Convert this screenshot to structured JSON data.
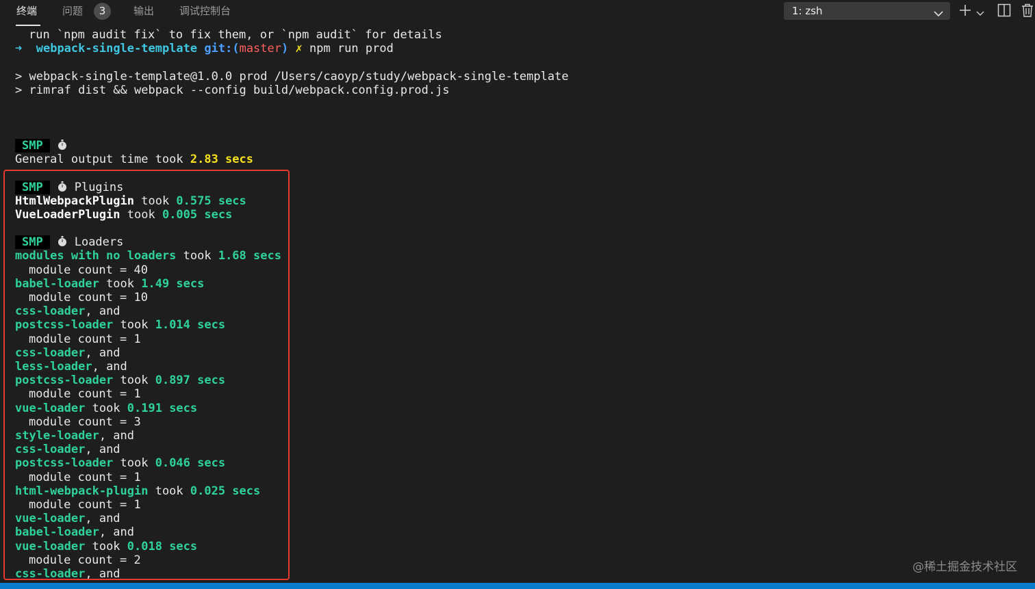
{
  "tabs": [
    {
      "label": "终端",
      "active": true
    },
    {
      "label": "问题",
      "badge": "3"
    },
    {
      "label": "输出"
    },
    {
      "label": "调试控制台"
    }
  ],
  "terminal_selector": {
    "value": "1: zsh"
  },
  "icons": [
    "plus-icon",
    "chevron-down-icon",
    "split-icon",
    "trash-icon",
    "stopwatch-icon"
  ],
  "colors": {
    "accent_green": "#2fd29a",
    "highlight_border": "#e63a2e",
    "statusbar": "#0a7acc"
  },
  "terminal": {
    "l1": "run `npm audit fix` to fix them, or `npm audit` for details",
    "prompt_arrow": "➜",
    "prompt_dir": "webpack-single-template",
    "prompt_git": "git:(",
    "prompt_branch": "master",
    "prompt_git_close": ")",
    "prompt_x": "✗",
    "prompt_cmd": "npm run prod",
    "l3": "> webpack-single-template@1.0.0 prod /Users/caoyp/study/webpack-single-template",
    "l4": "> rimraf dist && webpack --config build/webpack.config.prod.js",
    "smp": "SMP",
    "general_text": "General output time took ",
    "general_time": "2.83 secs",
    "plugins_title": "Plugins",
    "plugin1_name": "HtmlWebpackPlugin",
    "plugin1_time": "0.575 secs",
    "plugin2_name": "VueLoaderPlugin",
    "plugin2_time": "0.005 secs",
    "loaders_title": "Loaders",
    "took": " took ",
    "and": ", and",
    "loader_no": "modules with no loaders",
    "loader_no_time": "1.68 secs",
    "count_40": "module count = 40",
    "babel": "babel-loader",
    "babel_time": "1.49 secs",
    "count_10": "module count = 10",
    "css": "css-loader",
    "postcss": "postcss-loader",
    "postcss_time1": "1.014 secs",
    "count_1": "module count = 1",
    "less": "less-loader",
    "postcss_time2": "0.897 secs",
    "vue": "vue-loader",
    "vue_time1": "0.191 secs",
    "count_3": "module count = 3",
    "style": "style-loader",
    "postcss_time3": "0.046 secs",
    "html_plugin": "html-webpack-plugin",
    "html_time": "0.025 secs",
    "vue_time2": "0.018 secs",
    "count_2": "module count = 2"
  },
  "watermark": "@稀土掘金技术社区"
}
